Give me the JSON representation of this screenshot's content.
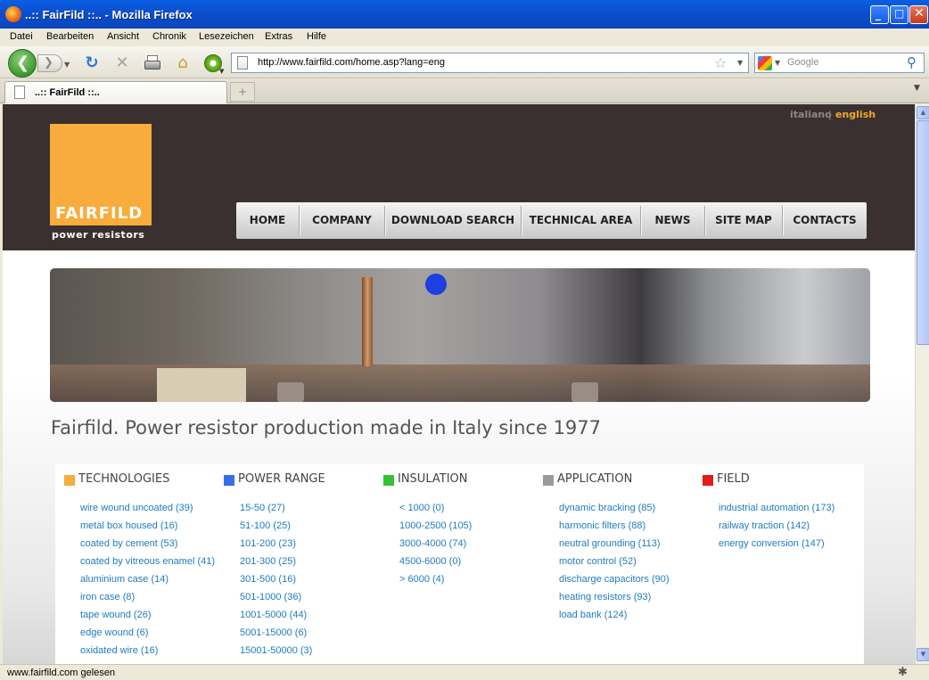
{
  "window": {
    "title": "..:: FairFild ::.. - Mozilla Firefox"
  },
  "menu": [
    "Datei",
    "Bearbeiten",
    "Ansicht",
    "Chronik",
    "Lesezeichen",
    "Extras",
    "Hilfe"
  ],
  "toolbar": {
    "url": "http://www.fairfild.com/home.asp?lang=eng",
    "search_placeholder": "Google",
    "icons": [
      "back-arrow-icon",
      "forward-arrow-icon",
      "reload-icon",
      "stop-icon",
      "print-icon",
      "home-icon",
      "addon-icon",
      "bookmark-star-icon",
      "search-magnifier-icon"
    ]
  },
  "tab": {
    "title": "..:: FairFild ::..",
    "new_tab": "+"
  },
  "page": {
    "languages": {
      "italian": "italiano",
      "separator": "|",
      "english": "english",
      "active_color": "#f0a92a"
    },
    "logo": {
      "word": "FAIRFILD",
      "subtitle": "power resistors",
      "color": "#f7ac3b"
    },
    "nav": [
      "HOME",
      "COMPANY",
      "DOWNLOAD SEARCH",
      "TECHNICAL AREA",
      "NEWS",
      "SITE MAP",
      "CONTACTS"
    ],
    "headline": "Fairfild. Power resistor production made in Italy since 1977",
    "categories": [
      {
        "title": "TECHNOLOGIES",
        "color": "#f7ac3b",
        "items": [
          "wire wound uncoated (39)",
          "metal box housed (16)",
          "coated by cement (53)",
          "coated by vitreous enamel (41)",
          "aluminium case (14)",
          "iron case (8)",
          "tape wound (26)",
          "edge wound (6)",
          "oxidated wire (16)"
        ]
      },
      {
        "title": "POWER RANGE",
        "color": "#3a6ee8",
        "items": [
          "15-50 (27)",
          "51-100 (25)",
          "101-200 (23)",
          "201-300 (25)",
          "301-500 (16)",
          "501-1000 (36)",
          "1001-5000 (44)",
          "5001-15000 (6)",
          "15001-50000 (3)"
        ]
      },
      {
        "title": "INSULATION",
        "color": "#33c233",
        "items": [
          "< 1000 (0)",
          "1000-2500 (105)",
          "3000-4000 (74)",
          "4500-6000 (0)",
          "> 6000 (4)"
        ]
      },
      {
        "title": "APPLICATION",
        "color": "#9a9a9a",
        "items": [
          "dynamic bracking (85)",
          "harmonic filters (88)",
          "neutral grounding (113)",
          "motor control (52)",
          "discharge capacitors (90)",
          "heating resistors (93)",
          "load bank (124)"
        ]
      },
      {
        "title": "FIELD",
        "color": "#e21b1b",
        "items": [
          "industrial automation (173)",
          "railway traction (142)",
          "energy conversion (147)"
        ]
      }
    ]
  },
  "status": {
    "text": "www.fairfild.com gelesen"
  }
}
